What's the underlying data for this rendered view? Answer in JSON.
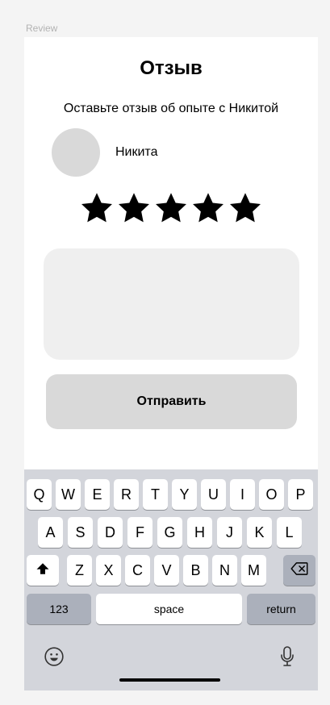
{
  "frame_label": "Review",
  "header": {
    "title": "Отзыв"
  },
  "subtitle": "Оставьте отзыв об опыте с Никитой",
  "user": {
    "name": "Никита"
  },
  "rating": {
    "value": 5,
    "max": 5
  },
  "review": {
    "value": "",
    "placeholder": ""
  },
  "submit": {
    "label": "Отправить"
  },
  "keyboard": {
    "row1": [
      "Q",
      "W",
      "E",
      "R",
      "T",
      "Y",
      "U",
      "I",
      "O",
      "P"
    ],
    "row2": [
      "A",
      "S",
      "D",
      "F",
      "G",
      "H",
      "J",
      "K",
      "L"
    ],
    "row3": [
      "Z",
      "X",
      "C",
      "V",
      "B",
      "N",
      "M"
    ],
    "numbers_label": "123",
    "space_label": "space",
    "return_label": "return"
  },
  "icons": {
    "shift": "shift-icon",
    "backspace": "backspace-icon",
    "emoji": "emoji-icon",
    "mic": "microphone-icon"
  }
}
